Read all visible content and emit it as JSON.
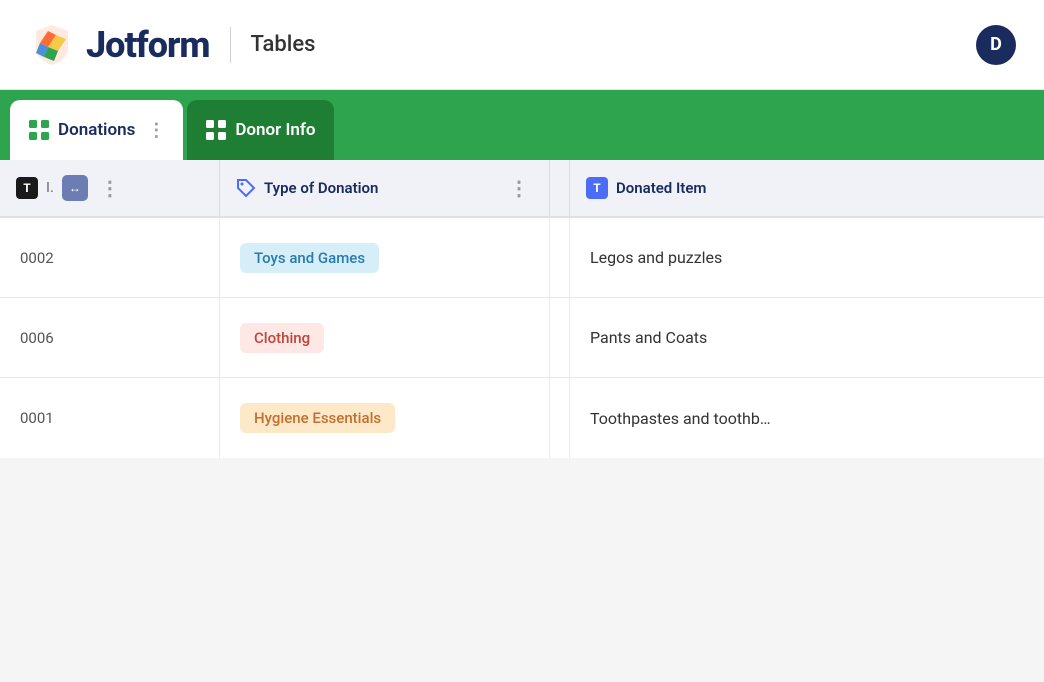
{
  "header": {
    "logo_text": "Jotform",
    "product_label": "Tables",
    "user_initial": "D"
  },
  "tabs": [
    {
      "id": "donations",
      "label": "Donations",
      "active": false
    },
    {
      "id": "donor-info",
      "label": "Donor Info",
      "active": true
    }
  ],
  "table": {
    "columns": [
      {
        "id": "row-id",
        "label": "I.",
        "icon": "T-icon"
      },
      {
        "id": "type-of-donation",
        "label": "Type of Donation",
        "icon": "tag-icon"
      },
      {
        "id": "donated-item",
        "label": "Donated Item",
        "icon": "T-icon"
      }
    ],
    "rows": [
      {
        "id": "0002",
        "donation_type": "Toys and Games",
        "donation_type_style": "toys",
        "donated_item": "Legos and puzzles"
      },
      {
        "id": "0006",
        "donation_type": "Clothing",
        "donation_type_style": "clothing",
        "donated_item": "Pants and Coats"
      },
      {
        "id": "0001",
        "donation_type": "Hygiene Essentials",
        "donation_type_style": "hygiene",
        "donated_item": "Toothpastes and toothb…"
      }
    ]
  },
  "icons": {
    "grid": "⊞",
    "T": "T",
    "tag": "🏷",
    "expand": "↔",
    "dots": "⋮"
  }
}
